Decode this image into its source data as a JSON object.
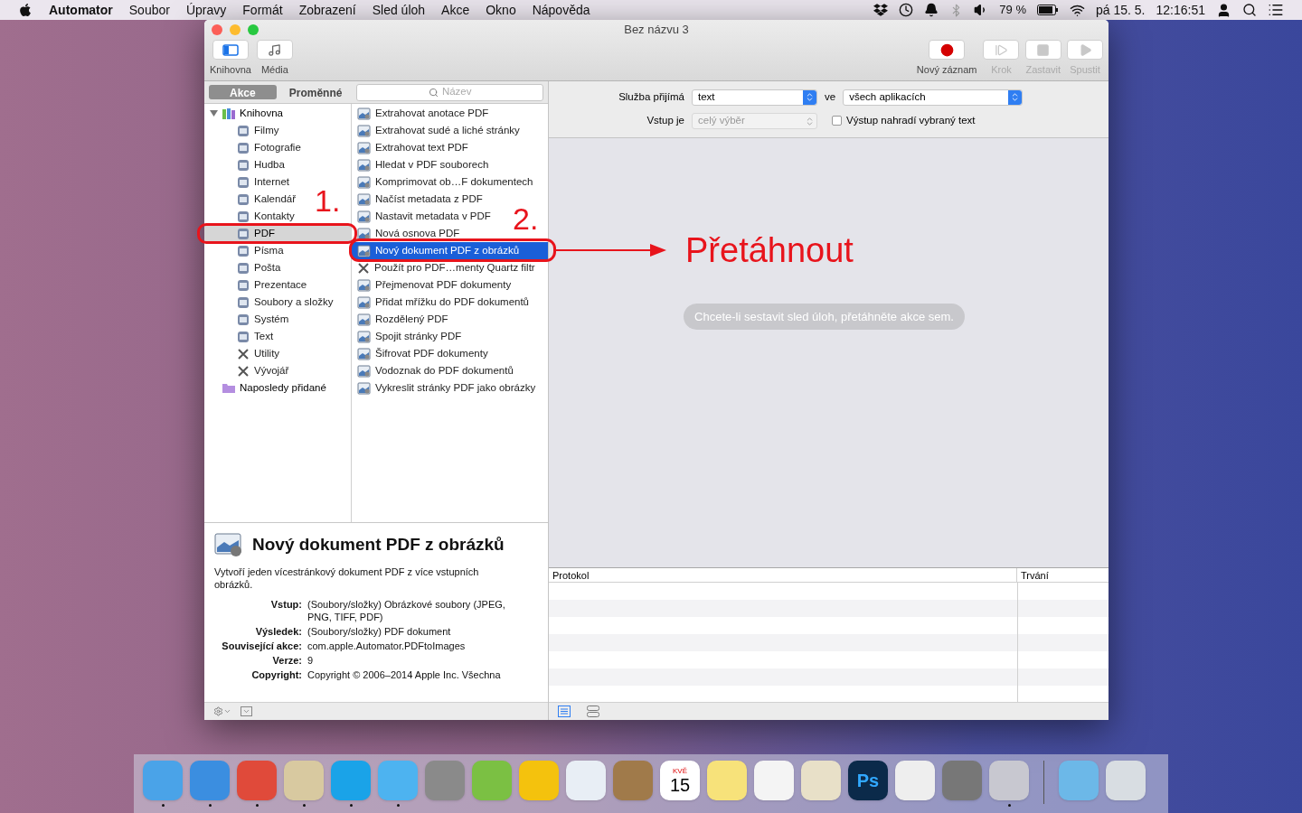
{
  "menu_bar": {
    "app": "Automator",
    "menus": [
      "Soubor",
      "Úpravy",
      "Formát",
      "Zobrazení",
      "Sled úloh",
      "Akce",
      "Okno",
      "Nápověda"
    ],
    "battery": "79 %",
    "date": "pá 15. 5.",
    "time": "12:16:51"
  },
  "window": {
    "title": "Bez názvu 3",
    "toolbar_left": [
      {
        "label": "Knihovna",
        "selected": true
      },
      {
        "label": "Média",
        "selected": false
      }
    ],
    "toolbar_right": [
      {
        "label": "Nový záznam",
        "kind": "record",
        "disabled": false
      },
      {
        "label": "Krok",
        "kind": "step",
        "disabled": true
      },
      {
        "label": "Zastavit",
        "kind": "stop",
        "disabled": true
      },
      {
        "label": "Spustit",
        "kind": "run",
        "disabled": true
      }
    ]
  },
  "library": {
    "tabs": [
      {
        "label": "Akce",
        "selected": true
      },
      {
        "label": "Proměnné",
        "selected": false
      }
    ],
    "search": {
      "placeholder": "Název"
    },
    "categories": [
      {
        "label": "Knihovna",
        "kind": "library",
        "selected": false,
        "expanded": true,
        "children": [
          {
            "label": "Filmy",
            "kind": "app",
            "selected": false
          },
          {
            "label": "Fotografie",
            "kind": "app",
            "selected": false
          },
          {
            "label": "Hudba",
            "kind": "app",
            "selected": false
          },
          {
            "label": "Internet",
            "kind": "app",
            "selected": false
          },
          {
            "label": "Kalendář",
            "kind": "app",
            "selected": false
          },
          {
            "label": "Kontakty",
            "kind": "app",
            "selected": false
          },
          {
            "label": "PDF",
            "kind": "app",
            "selected": true
          },
          {
            "label": "Písma",
            "kind": "app",
            "selected": false
          },
          {
            "label": "Pošta",
            "kind": "app",
            "selected": false
          },
          {
            "label": "Prezentace",
            "kind": "app",
            "selected": false
          },
          {
            "label": "Soubory a složky",
            "kind": "app",
            "selected": false
          },
          {
            "label": "Systém",
            "kind": "app",
            "selected": false
          },
          {
            "label": "Text",
            "kind": "app",
            "selected": false
          },
          {
            "label": "Utility",
            "kind": "tools",
            "selected": false
          },
          {
            "label": "Vývojář",
            "kind": "tools",
            "selected": false
          }
        ]
      },
      {
        "label": "Naposledy přidané",
        "kind": "folder",
        "selected": false
      }
    ],
    "actions": [
      {
        "label": "Extrahovat anotace PDF",
        "kind": "document",
        "selected": false
      },
      {
        "label": "Extrahovat sudé a liché stránky",
        "kind": "document",
        "selected": false
      },
      {
        "label": "Extrahovat text PDF",
        "kind": "document",
        "selected": false
      },
      {
        "label": "Hledat v PDF souborech",
        "kind": "document",
        "selected": false
      },
      {
        "label": "Komprimovat ob…F dokumentech",
        "kind": "document",
        "selected": false
      },
      {
        "label": "Načíst metadata z PDF",
        "kind": "document",
        "selected": false
      },
      {
        "label": "Nastavit metadata v PDF",
        "kind": "document",
        "selected": false
      },
      {
        "label": "Nová osnova PDF",
        "kind": "document",
        "selected": false
      },
      {
        "label": "Nový dokument PDF z obrázků",
        "kind": "document",
        "selected": true
      },
      {
        "label": "Použít pro PDF…menty Quartz filtr",
        "kind": "tools",
        "selected": false
      },
      {
        "label": "Přejmenovat PDF dokumenty",
        "kind": "document",
        "selected": false
      },
      {
        "label": "Přidat mřížku do PDF dokumentů",
        "kind": "document",
        "selected": false
      },
      {
        "label": "Rozdělený PDF",
        "kind": "document",
        "selected": false
      },
      {
        "label": "Spojit stránky PDF",
        "kind": "document",
        "selected": false
      },
      {
        "label": "Šifrovat PDF dokumenty",
        "kind": "document",
        "selected": false
      },
      {
        "label": "Vodoznak do PDF dokumentů",
        "kind": "document",
        "selected": false
      },
      {
        "label": "Vykreslit stránky PDF jako obrázky",
        "kind": "document",
        "selected": false
      }
    ]
  },
  "description": {
    "title": "Nový dokument PDF z obrázků",
    "text": "Vytvoří jeden vícestránkový dokument PDF z více vstupních obrázků.",
    "fields": [
      {
        "label": "Vstup:",
        "value": "(Soubory/složky) Obrázkové soubory (JPEG, PNG, TIFF, PDF)"
      },
      {
        "label": "Výsledek:",
        "value": "(Soubory/složky) PDF dokument"
      },
      {
        "label": "Související akce:",
        "value": "com.apple.Automator.PDFtoImages"
      },
      {
        "label": "Verze:",
        "value": "9"
      },
      {
        "label": "Copyright:",
        "value": "Copyright © 2006–2014 Apple Inc. Všechna"
      }
    ]
  },
  "service": {
    "receives_label": "Služba přijímá",
    "receives_value": "text",
    "in_label": "ve",
    "in_value": "všech aplikacích",
    "input_label": "Vstup je",
    "input_value": "celý výběr",
    "input_disabled": true,
    "replace": {
      "label": "Výstup nahradí vybraný text",
      "checked": false
    }
  },
  "workflow": {
    "hint": "Chcete-li sestavit sled úloh, přetáhněte akce sem."
  },
  "log": {
    "columns": [
      "Protokol",
      "Trvání"
    ]
  },
  "annotations": {
    "step_1": "1.",
    "step_2": "2.",
    "drag_label": "Přetáhnout"
  },
  "dock": {
    "apps": [
      {
        "color": "#4aa3e8",
        "running": true
      },
      {
        "color": "#3b8ee0",
        "running": true
      },
      {
        "color": "#e04a3a",
        "running": true
      },
      {
        "color": "#d8c9a0",
        "running": true
      },
      {
        "color": "#1aa3e8",
        "running": true
      },
      {
        "color": "#4db3f0",
        "running": true
      },
      {
        "color": "#8a8a8a",
        "running": false
      },
      {
        "color": "#7bc043",
        "running": false
      },
      {
        "color": "#f4c20d",
        "running": false
      },
      {
        "color": "#e8eef5",
        "running": false
      },
      {
        "color": "#a07a4a",
        "running": false
      },
      {
        "color": "#ffffff",
        "running": false,
        "month": "KVĚ",
        "day": "15"
      },
      {
        "color": "#f7e27a",
        "running": false
      },
      {
        "color": "#f4f4f4",
        "running": false
      },
      {
        "color": "#e8e0c8",
        "running": false
      },
      {
        "color": "#0b2a4a",
        "running": false,
        "label": "Ps"
      },
      {
        "color": "#eeeeee",
        "running": false
      },
      {
        "color": "#777777",
        "running": false
      },
      {
        "color": "#c8c8d0",
        "running": true
      }
    ],
    "stacks": [
      {
        "color": "#6cb8e8",
        "running": false
      },
      {
        "color": "#d8dde2",
        "running": false
      }
    ]
  }
}
